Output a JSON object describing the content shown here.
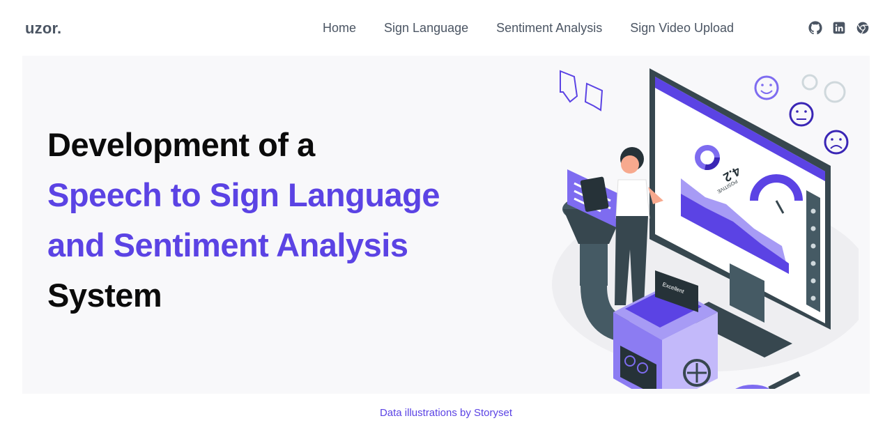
{
  "brand": {
    "logo": "uzor."
  },
  "nav": {
    "items": [
      {
        "label": "Home"
      },
      {
        "label": "Sign Language"
      },
      {
        "label": "Sentiment Analysis"
      },
      {
        "label": "Sign Video Upload"
      }
    ]
  },
  "social": {
    "icons": [
      "github-icon",
      "linkedin-icon",
      "chrome-icon"
    ]
  },
  "hero": {
    "line1": "Development of a",
    "line2": "Speech to Sign Language",
    "line3": "and Sentiment Analysis",
    "line4": "System"
  },
  "illustration": {
    "rating": "4.2",
    "rating_label": "POSITIVE",
    "tag": "Excellent"
  },
  "footer": {
    "credit": "Data illustrations by Storyset"
  },
  "colors": {
    "accent": "#5b43e4",
    "text": "#4b5563",
    "hero_bg": "#f8f8fa"
  }
}
